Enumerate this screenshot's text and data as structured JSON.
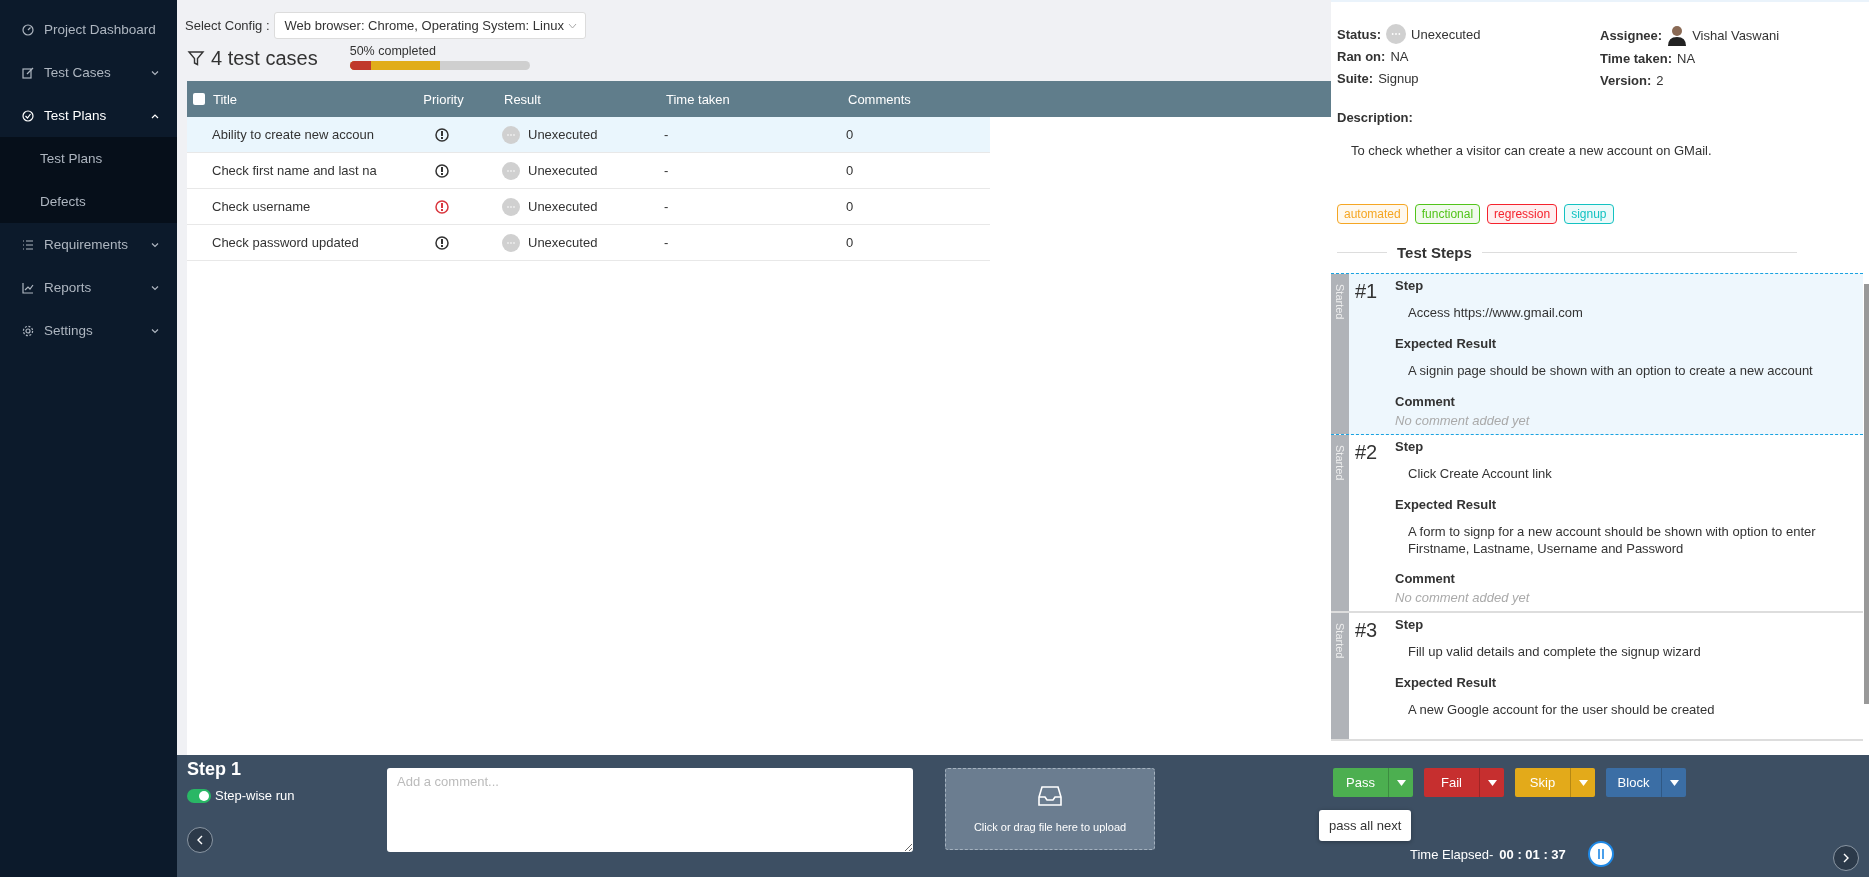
{
  "sidebar": {
    "items": [
      {
        "label": "Project Dashboard",
        "selected": false
      },
      {
        "label": "Test Cases",
        "expanded": false,
        "selected": false
      },
      {
        "label": "Test Plans",
        "expanded": true,
        "selected": true,
        "children": [
          {
            "label": "Test Plans"
          },
          {
            "label": "Defects"
          }
        ]
      },
      {
        "label": "Requirements",
        "expanded": false,
        "selected": false
      },
      {
        "label": "Reports",
        "expanded": false,
        "selected": false
      },
      {
        "label": "Settings",
        "expanded": false,
        "selected": false
      }
    ]
  },
  "config": {
    "label": "Select Config :",
    "value": "Web browser: Chrome, Operating System: Linux"
  },
  "summary": {
    "count": "4 test cases",
    "progress_label": "50% completed",
    "segments": [
      {
        "level": 0.5,
        "color": "#e1ad1a"
      },
      {
        "level": 0.12,
        "color": "#c0392b"
      }
    ]
  },
  "table": {
    "select_all_checked": false,
    "columns": [
      "Title",
      "Priority",
      "Result",
      "Time taken",
      "Comments"
    ],
    "rows": [
      {
        "title": "Ability to create new accoun",
        "color": "#333333",
        "result": "Unexecuted",
        "time": "-",
        "comments": "0",
        "selected": true
      },
      {
        "title": "Check first name and last na",
        "color": "#333333",
        "result": "Unexecuted",
        "time": "-",
        "comments": "0",
        "selected": false
      },
      {
        "title": "Check username",
        "color": "#d9363e",
        "result": "Unexecuted",
        "time": "-",
        "comments": "0",
        "selected": false
      },
      {
        "title": "Check password updated",
        "color": "#333333",
        "result": "Unexecuted",
        "time": "-",
        "comments": "0",
        "selected": false
      }
    ]
  },
  "details": {
    "status_label": "Status:",
    "status": "Unexecuted",
    "ran_on_label": "Ran on:",
    "ran_on": "NA",
    "suite_label": "Suite:",
    "suite": "Signup",
    "assignee_label": "Assignee:",
    "assignee": "Vishal Vaswani",
    "time_label": "Time taken:",
    "time": "NA",
    "version_label": "Version:",
    "version": "2",
    "description_label": "Description:",
    "description": "To check whether a visitor can create a new account on GMail.",
    "tags": [
      {
        "label": "automated",
        "color": "#f5a623"
      },
      {
        "label": "functional",
        "color": "#52c41a"
      },
      {
        "label": "regression",
        "color": "#f5222d"
      },
      {
        "label": "signup",
        "color": "#13c2c2"
      }
    ],
    "steps_title": "Test Steps",
    "steps": [
      {
        "state": "Started",
        "number": "#1",
        "selected": true,
        "fields": [
          {
            "label": "Step",
            "text": "Access https://www.gmail.com",
            "kind": "text"
          },
          {
            "label": "Expected Result",
            "text": "A signin page should be shown with an option to create a new account",
            "kind": "text"
          },
          {
            "label": "Comment",
            "text": "No comment added yet",
            "kind": "empty"
          }
        ]
      },
      {
        "state": "Started",
        "number": "#2",
        "selected": false,
        "fields": [
          {
            "label": "Step",
            "text": "Click Create Account link",
            "kind": "text"
          },
          {
            "label": "Expected Result",
            "text": "A form to signp for a new account should be shown with option to enter Firstname, Lastname, Username and Password",
            "kind": "text"
          },
          {
            "label": "Comment",
            "text": "No comment added yet",
            "kind": "empty"
          }
        ]
      },
      {
        "state": "Started",
        "number": "#3",
        "selected": false,
        "fields": [
          {
            "label": "Step",
            "text": "Fill up valid details and complete the signup wizard",
            "kind": "text"
          },
          {
            "label": "Expected Result",
            "text": "A new Google account for the user should be created",
            "kind": "text"
          }
        ]
      }
    ]
  },
  "bottom": {
    "title": "Step 1",
    "toggle": {
      "label": "Step-wise run",
      "on": true
    },
    "comment": {
      "placeholder": "Add a comment..."
    },
    "upload": "Click or drag file here to upload",
    "buttons": [
      {
        "label": "Pass",
        "color": "#4caf50"
      },
      {
        "label": "Fail",
        "color": "#c62f2f"
      },
      {
        "label": "Skip",
        "color": "#e3aa1a"
      },
      {
        "label": "Block",
        "color": "#3b6ea5"
      }
    ],
    "tooltip": "pass all next",
    "elapsed_label": "Time Elapsed-",
    "elapsed": "00 : 01 : 37"
  }
}
